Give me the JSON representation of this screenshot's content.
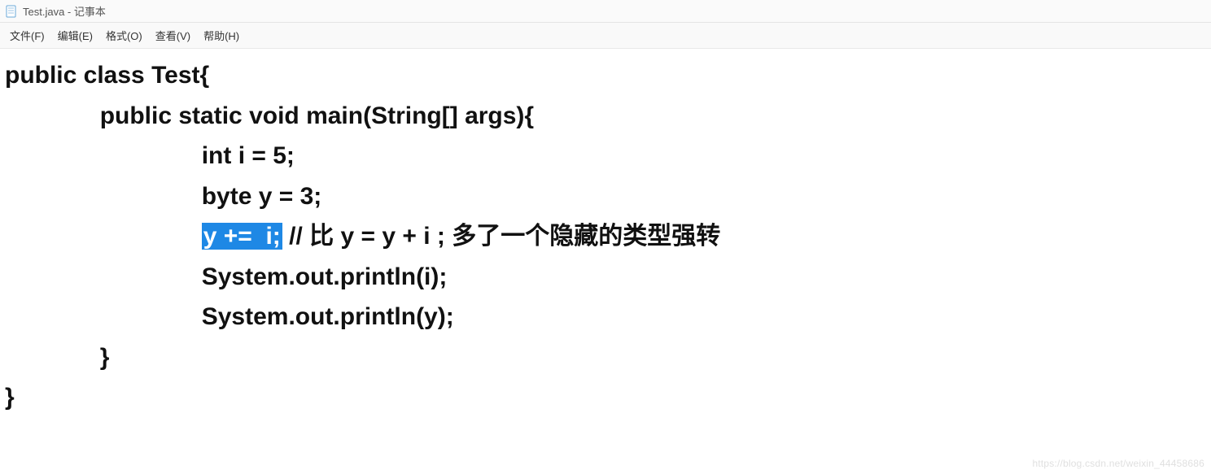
{
  "window": {
    "title": "Test.java - 记事本"
  },
  "menu": {
    "file": "文件(F)",
    "edit": "编辑(E)",
    "format": "格式(O)",
    "view": "查看(V)",
    "help": "帮助(H)"
  },
  "code": {
    "line1": "public class Test{",
    "line2_indent": "              ",
    "line2": "public static void main(String[] args){",
    "line3_indent": "                             ",
    "line3": "int i = 5;",
    "line4_indent": "                             ",
    "line4": "byte y = 3;",
    "line5_indent": "                             ",
    "line5_hl": "y +=  i;",
    "line5_rest": " // 比 y = y + i ; 多了一个隐藏的类型强转",
    "line6_indent": "                             ",
    "line6": "System.out.println(i);",
    "line7_indent": "                             ",
    "line7": "System.out.println(y);",
    "line8_indent": "              ",
    "line8": "}",
    "line9": "}"
  },
  "watermark": "https://blog.csdn.net/weixin_44458686"
}
